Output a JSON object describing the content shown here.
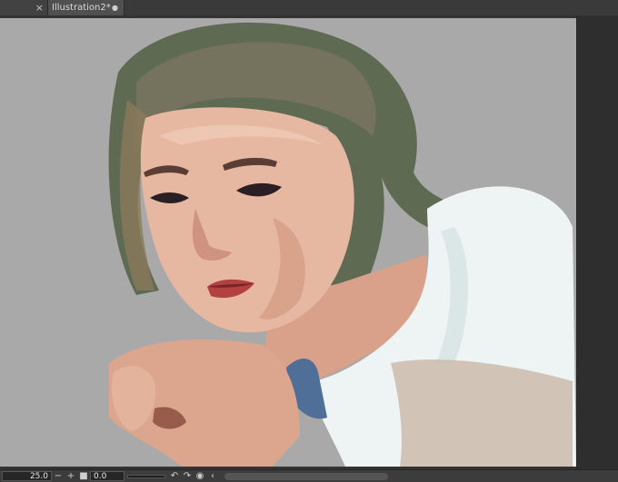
{
  "tabs": [
    {
      "label": "",
      "close_glyph": "×"
    },
    {
      "label": "Illustration2*",
      "modified_glyph": "●"
    }
  ],
  "statusbar": {
    "zoom_value": "25.0",
    "zoom_out_glyph": "−",
    "zoom_in_glyph": "+",
    "fit_glyph": "■",
    "rotation_value": "0.0",
    "rotate_left_glyph": "↶",
    "rotate_right_glyph": "↷",
    "reset_rotation_glyph": "◉",
    "flip_glyph": "‹"
  },
  "colors": {
    "canvas_bg": "#a9a9a9",
    "skin": "#e6b8a2",
    "hair": "#5f6a52",
    "shirt": "#eef3f3",
    "lips": "#b3413f",
    "denim": "#4f6f98"
  },
  "icons": [
    "close-icon",
    "modified-dot-icon",
    "zoom-out-icon",
    "zoom-in-icon",
    "fit-icon",
    "rotate-left-icon",
    "rotate-right-icon",
    "reset-rotation-icon",
    "flip-icon"
  ]
}
